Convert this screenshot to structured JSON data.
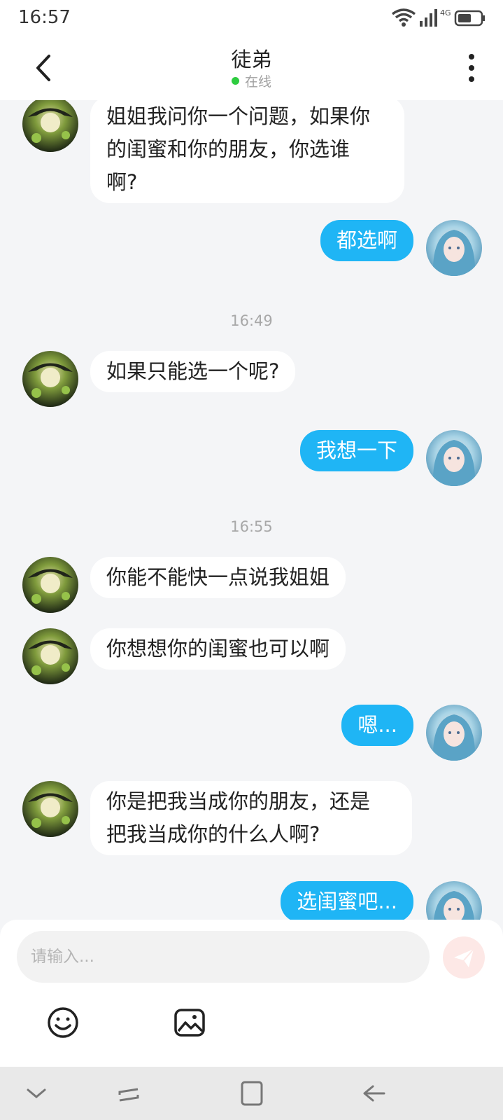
{
  "status_bar": {
    "time": "16:57",
    "network": "4G",
    "icons": [
      "wifi-icon",
      "signal-icon",
      "battery-icon"
    ]
  },
  "header": {
    "title": "徒弟",
    "presence": "在线",
    "back_icon": "chevron-left-icon",
    "more_icon": "more-vertical-icon"
  },
  "messages": [
    {
      "side": "left",
      "lines": [
        "姐姐我问你一个问题，如果你",
        "的闺蜜和你的朋友，你选谁",
        "啊?"
      ]
    },
    {
      "side": "right",
      "lines": [
        "都选啊"
      ]
    },
    {
      "timestamp": "16:49"
    },
    {
      "side": "left",
      "lines": [
        "如果只能选一个呢?"
      ]
    },
    {
      "side": "right",
      "lines": [
        "我想一下"
      ]
    },
    {
      "timestamp": "16:55"
    },
    {
      "side": "left",
      "lines": [
        "你能不能快一点说我姐姐"
      ]
    },
    {
      "side": "left",
      "lines": [
        "你想想你的闺蜜也可以啊"
      ]
    },
    {
      "side": "right",
      "lines": [
        "嗯..."
      ]
    },
    {
      "side": "left",
      "lines": [
        "你是把我当成你的朋友，还是",
        "把我当成你的什么人啊?"
      ]
    },
    {
      "side": "right",
      "lines": [
        "选闺蜜吧..."
      ]
    }
  ],
  "composer": {
    "placeholder": "请输入...",
    "send_icon": "send-icon",
    "tools": [
      "emoji-icon",
      "image-icon"
    ]
  },
  "colors": {
    "accent": "#1fb5f5",
    "background": "#f4f5f7",
    "online": "#2ecc40",
    "send_button": "#fde8e6"
  },
  "nav_bar": {
    "icons": [
      "chevron-down-icon",
      "recent-apps-icon",
      "home-icon",
      "back-arrow-icon"
    ]
  }
}
